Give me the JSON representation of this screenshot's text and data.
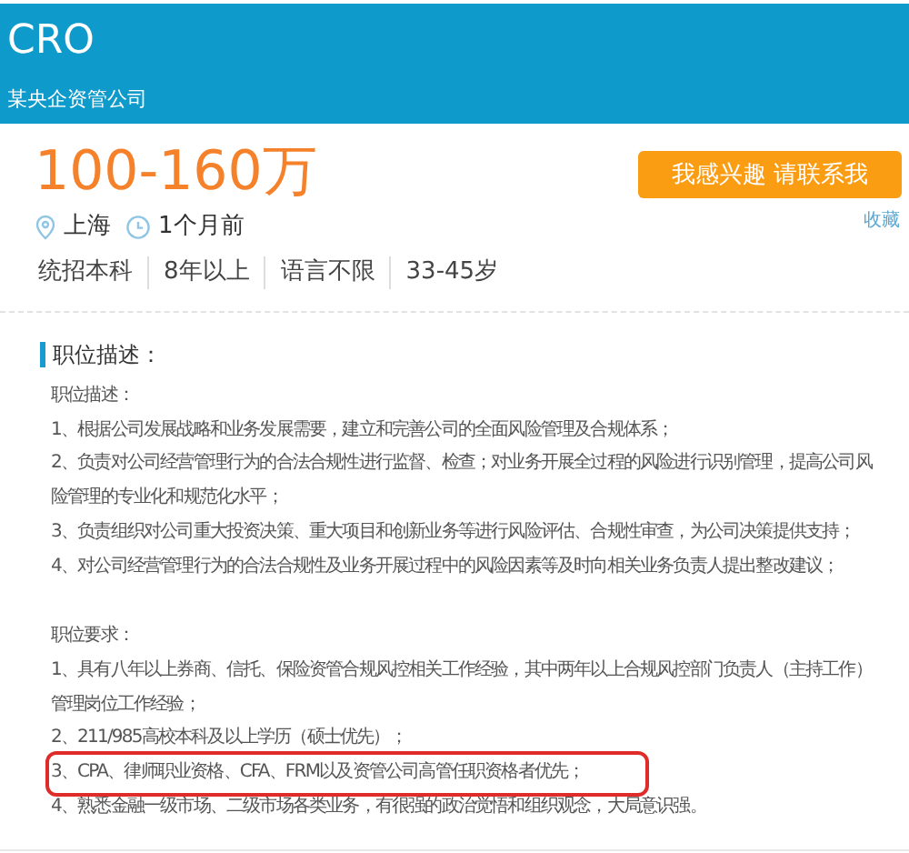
{
  "header": {
    "title": "CRO",
    "company": "某央企资管公司"
  },
  "summary": {
    "salary": "100-160万",
    "apply_button": "我感兴趣 请联系我",
    "favorite_link": "收藏",
    "location": "上海",
    "posted": "1个月前",
    "tags": [
      "统招本科",
      "8年以上",
      "语言不限",
      "33-45岁"
    ]
  },
  "section": {
    "heading": "职位描述：",
    "blocks": [
      {
        "heading": "职位描述：",
        "items": [
          {
            "text": "1、根据公司发展战略和业务发展需要，建立和完善公司的全面风险管理及合规体系；",
            "highlighted": false
          },
          {
            "text": "2、负责对公司经营管理行为的合法合规性进行监督、检查；对业务开展全过程的风险进行识别管理，提高公司风险管理的专业化和规范化水平；",
            "highlighted": false
          },
          {
            "text": "3、负责组织对公司重大投资决策、重大项目和创新业务等进行风险评估、合规性审查，为公司决策提供支持；",
            "highlighted": false
          },
          {
            "text": "4、对公司经营管理行为的合法合规性及业务开展过程中的风险因素等及时向相关业务负责人提出整改建议；",
            "highlighted": false
          }
        ]
      },
      {
        "heading": "职位要求：",
        "items": [
          {
            "text": "1、具有八年以上券商、信托、保险资管合规风控相关工作经验，其中两年以上合规风控部门负责人（主持工作）管理岗位工作经验；",
            "highlighted": false
          },
          {
            "text": "2、211/985高校本科及以上学历（硕士优先）；",
            "highlighted": false
          },
          {
            "text": "3、CPA、律师职业资格、CFA、FRM以及资管公司高管任职资格者优先；",
            "highlighted": true
          },
          {
            "text": "4、熟悉金融一级市场、二级市场各类业务，有很强的政治觉悟和组织观念，大局意识强。",
            "highlighted": false
          }
        ]
      }
    ]
  }
}
